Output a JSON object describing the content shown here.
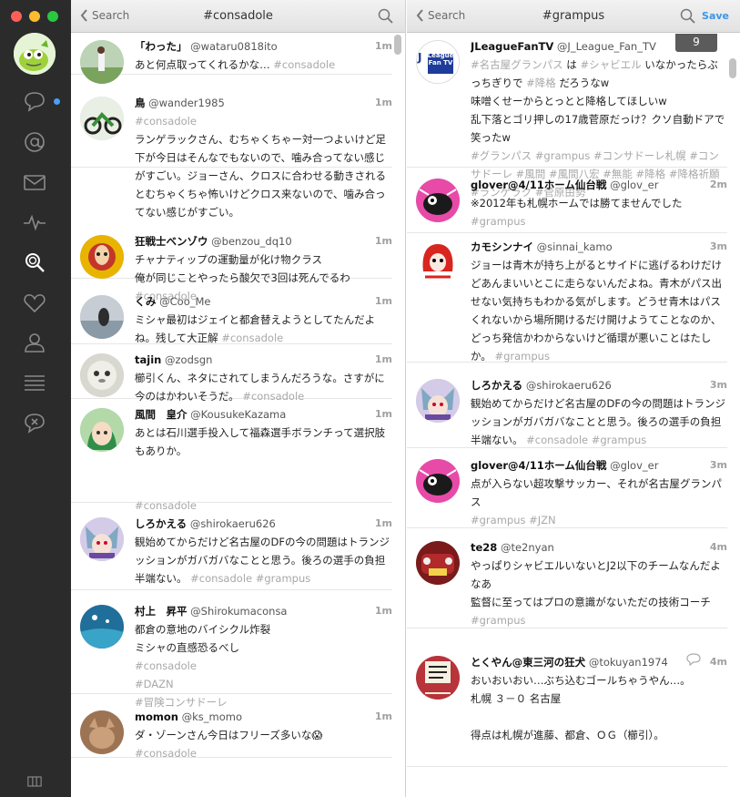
{
  "window": {
    "colors": {
      "close": "#ff5f57",
      "minimize": "#febc2e",
      "maximize": "#28c840",
      "accent": "#3d95e6",
      "sidebar": "#2b2b2b"
    }
  },
  "sidebar": {
    "items": [
      {
        "name": "messages-icon",
        "unread": true
      },
      {
        "name": "mentions-icon"
      },
      {
        "name": "direct-messages-icon"
      },
      {
        "name": "activity-icon"
      },
      {
        "name": "search-icon",
        "active": true
      },
      {
        "name": "likes-icon"
      },
      {
        "name": "profile-icon"
      },
      {
        "name": "lists-icon"
      },
      {
        "name": "muted-icon"
      }
    ],
    "footer_icon": "columns-icon"
  },
  "columns": [
    {
      "back": "Search",
      "title": "#consadole",
      "tweets": [
        {
          "name": "「わった」",
          "handle": "@wataru0818ito",
          "time": "1m",
          "lines": [
            "あと何点取ってくれるかな…"
          ],
          "tags": "#consadole",
          "tag_inline": true
        },
        {
          "name": "鳥",
          "handle": "@wander1985",
          "time": "1m",
          "tags_first": "#consadole",
          "lines": [
            "ランゲラックさん、むちゃくちゃー対一つよいけど足下が今日はそんなでもないので、噛み合ってない感じがすごい。ジョーさん、クロスに合わせる動きされるとむちゃくちゃ怖いけどクロス来ないので、噛み合ってない感じがすごい。"
          ]
        },
        {
          "name": "狂戦士ベンゾウ",
          "handle": "@benzou_dq10",
          "time": "1m",
          "lines": [
            "チャナティップの運動量が化け物クラス",
            "俺が同じことやったら酸欠で3回は死んでるわ"
          ],
          "tags": "#consadole"
        },
        {
          "name": "くみ",
          "handle": "@Coo_Me",
          "time": "1m",
          "lines": [
            "ミシャ最初はジェイと都倉替えようとしてたんだよね。残して大正解"
          ],
          "tags": "#consadole",
          "tag_inline": true
        },
        {
          "name": "tajin",
          "handle": "@zodsgn",
          "time": "1m",
          "lines": [
            "櫛引くん、ネタにされてしまうんだろうな。さすがに今のはかわいそうだ。"
          ],
          "tags": "#consadole",
          "tag_inline": true
        },
        {
          "name": "風間　皇介",
          "handle": "@KousukeKazama",
          "time": "1m",
          "lines": [
            "あとは石川選手投入して福森選手ボランチって選択肢もありか。",
            "",
            ""
          ],
          "tags": "#consadole"
        },
        {
          "name": "しろかえる",
          "handle": "@shirokaeru626",
          "time": "1m",
          "lines": [
            "観始めてからだけど名古屋のDFの今の問題はトランジッションがガバガバなことと思う。後ろの選手の負担半端ない。"
          ],
          "tags": "#consadole #grampus",
          "tag_inline": true
        },
        {
          "name": "村上　昇平",
          "handle": "@Shirokumaconsa",
          "time": "1m",
          "lines": [
            "都倉の意地のバイシクル炸裂",
            "ミシャの直感恐るべし"
          ],
          "tags_list": [
            "#consadole",
            "#DAZN",
            "#冒険コンサドーレ"
          ]
        },
        {
          "name": "momon",
          "handle": "@ks_momo",
          "time": "1m",
          "lines": [
            "ダ・ゾーンさん今日はフリーズ多いな😱"
          ],
          "tags": "#consadole"
        }
      ]
    },
    {
      "back": "Search",
      "title": "#grampus",
      "save": "Save",
      "new_count": "9",
      "tweets": [
        {
          "name": "JLeagueFanTV",
          "handle": "@J_League_Fan_TV",
          "time": "",
          "avatar_text": [
            "J",
            "League",
            "Fan TV"
          ],
          "html_lines": [
            [
              "#名古屋グランパス",
              "t",
              " は ",
              "x",
              "#シャビエル",
              "t",
              " いなかったらぶっちぎりで ",
              "x",
              "#降格",
              "t",
              " だろうなw",
              "x"
            ],
            [
              "味噌くせーからとっとと降格してほしいw",
              "x"
            ],
            [
              "乱下落とゴリ押しの17歳菅原だっけ？クソ自動ドアで笑ったw",
              "x"
            ],
            [
              "#グランパス #grampus #コンサドーレ札幌 #コンサドーレ #風間 #風間八宏 #無能 #降格 #降格祈願 #ランゲラク #菅原由勢",
              "t"
            ]
          ]
        },
        {
          "name": "glover@4/11ホーム仙台戦",
          "handle": "@glov_er",
          "time": "2m",
          "lines": [
            "※2012年も札幌ホームでは勝てませんでした"
          ],
          "tags": "#grampus"
        },
        {
          "name": "カモシンナイ",
          "handle": "@sinnai_kamo",
          "time": "3m",
          "lines": [
            "ジョーは青木が持ち上がるとサイドに逃げるわけだけどあんまいいとこに走らないんだよね。青木がパス出せない気持ちもわかる気がします。どうせ青木はパスくれないから場所開けるだけ開けようてことなのか、どっち発信かわからないけど循環が悪いことはたしか。"
          ],
          "tags": "#grampus",
          "tag_inline": true
        },
        {
          "name": "しろかえる",
          "handle": "@shirokaeru626",
          "time": "3m",
          "lines": [
            "観始めてからだけど名古屋のDFの今の問題はトランジッションがガバガバなことと思う。後ろの選手の負担半端ない。"
          ],
          "tags": "#consadole #grampus",
          "tag_inline": true
        },
        {
          "name": "glover@4/11ホーム仙台戦",
          "handle": "@glov_er",
          "time": "3m",
          "lines": [
            "点が入らない超攻撃サッカー、それが名古屋グランパス"
          ],
          "tags": "#grampus  #JZN"
        },
        {
          "name": "te28",
          "handle": "@te2nyan",
          "time": "4m",
          "lines": [
            "やっぱりシャビエルいないとJ2以下のチームなんだよなあ",
            "監督に至ってはプロの意識がないただの技術コーチ"
          ],
          "tags": "#grampus"
        },
        {
          "name": "とくやん@東三河の狂犬",
          "handle": "@tokuyan1974",
          "time": "4m",
          "has_reply": true,
          "lines": [
            "おいおいおい…ぶち込むゴールちゃうやん…。",
            "札幌 ３－０ 名古屋",
            "",
            "得点は札幌が進藤、都倉、ＯＧ（櫛引）。"
          ]
        }
      ]
    }
  ]
}
